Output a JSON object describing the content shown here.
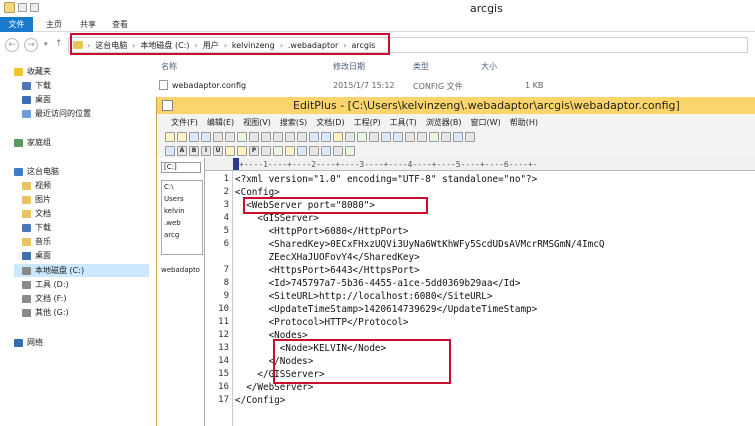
{
  "explorer": {
    "title": "arcgis",
    "tabs": [
      "文件",
      "主页",
      "共享",
      "查看"
    ],
    "address": [
      "这台电脑",
      "本地磁盘 (C:)",
      "用户",
      "kelvinzeng",
      ".webadaptor",
      "arcgis"
    ],
    "nav": {
      "favorites": "收藏夹",
      "downloads": "下载",
      "desktop": "桌面",
      "recent": "最近访问的位置",
      "homegroup": "家庭组",
      "this_pc": "这台电脑",
      "videos": "视频",
      "pictures": "图片",
      "documents": "文档",
      "downloads2": "下载",
      "music": "音乐",
      "desktop2": "桌面",
      "drive_c": "本地磁盘 (C:)",
      "drive_d": "工具 (D:)",
      "drive_f": "文档 (F:)",
      "drive_g": "其他 (G:)",
      "network": "网络"
    },
    "columns": {
      "name": "名称",
      "modified": "修改日期",
      "type": "类型",
      "size": "大小"
    },
    "file": {
      "name": "webadaptor.config",
      "modified": "2015/1/7 15:12",
      "type": "CONFIG 文件",
      "size": "1 KB"
    }
  },
  "editplus": {
    "title": "EditPlus - [C:\\Users\\kelvinzeng\\.webadaptor\\arcgis\\webadaptor.config]",
    "menu": [
      "文件(F)",
      "编辑(E)",
      "视图(V)",
      "搜索(S)",
      "文档(D)",
      "工程(P)",
      "工具(T)",
      "浏览器(B)",
      "窗口(W)",
      "帮助(H)"
    ],
    "drive": "[C:]",
    "tree": [
      "C:\\",
      "Users",
      "kelvin",
      ".web",
      "arcg"
    ],
    "file_list": [
      "webadapto"
    ],
    "ruler": "+----1----+----2----+----3----+----4----+----5----+----6----+-",
    "lines": [
      {
        "n": "1",
        "text": "<?xml version=\"1.0\" encoding=\"UTF-8\" standalone=\"no\"?>"
      },
      {
        "n": "2",
        "text": "<Config>"
      },
      {
        "n": "3",
        "text": "  <WebServer port=\"8080\">"
      },
      {
        "n": "4",
        "text": "    <GISServer>"
      },
      {
        "n": "5",
        "text": "      <HttpPort>6080</HttpPort>"
      },
      {
        "n": "6",
        "text": "      <SharedKey>0ECxFHxzUQVi3UyNa6WtKhWFy5ScdUDsAVMcrRMSGmN/4ImcQ"
      },
      {
        "n": "",
        "text": "      ZEecXHaJUOFovY4</SharedKey>"
      },
      {
        "n": "7",
        "text": "      <HttpsPort>6443</HttpsPort>"
      },
      {
        "n": "8",
        "text": "      <Id>745797a7-5b36-4455-a1ce-5dd0369b29aa</Id>"
      },
      {
        "n": "9",
        "text": "      <SiteURL>http://localhost:6080</SiteURL>"
      },
      {
        "n": "10",
        "text": "      <UpdateTimeStamp>1420614739629</UpdateTimeStamp>"
      },
      {
        "n": "11",
        "text": "      <Protocol>HTTP</Protocol>"
      },
      {
        "n": "12",
        "text": "      <Nodes>"
      },
      {
        "n": "13",
        "text": "        <Node>KELVIN</Node>"
      },
      {
        "n": "14",
        "text": "      </Nodes>"
      },
      {
        "n": "15",
        "text": "    </GISServer>"
      },
      {
        "n": "16",
        "text": "  </WebServer>"
      },
      {
        "n": "17",
        "text": "</Config>"
      }
    ]
  },
  "colors": {
    "highlight": "#c8102e",
    "editplus_title": "#fbd56b",
    "explorer_file_tab": "#1979ca"
  }
}
